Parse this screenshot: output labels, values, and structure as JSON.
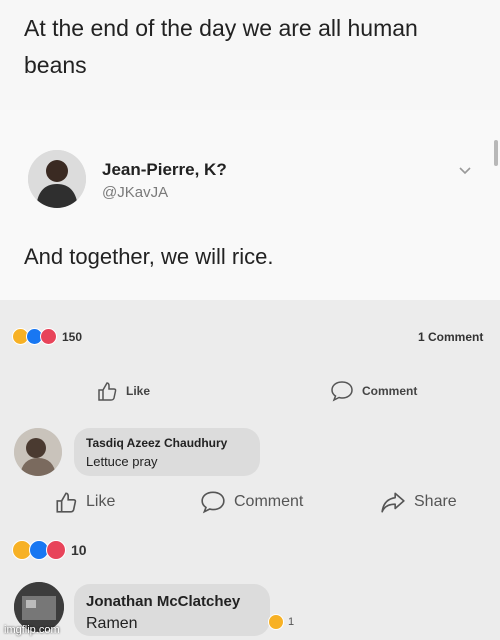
{
  "tweet_top": {
    "text": "At the end of the day we are all human beans"
  },
  "tweet": {
    "author_name": "Jean-Pierre, K?",
    "author_handle": "@JKavJA",
    "text": "And together, we will rice."
  },
  "post_stats": {
    "reaction_count": "150",
    "comment_count": "1 Comment"
  },
  "post_actions": {
    "like": "Like",
    "comment": "Comment"
  },
  "comment1": {
    "author": "Tasdiq Azeez Chaudhury",
    "text": "Lettuce pray"
  },
  "outer_actions": {
    "like": "Like",
    "comment": "Comment",
    "share": "Share"
  },
  "outer_stats": {
    "reaction_count": "10"
  },
  "comment2": {
    "author": "Jonathan McClatchey",
    "text": "Ramen",
    "reaction_count": "1"
  },
  "watermark": "imgflip.com",
  "colors": {
    "haha": "#f7b125",
    "like": "#1877f2",
    "love": "#e8445a"
  }
}
